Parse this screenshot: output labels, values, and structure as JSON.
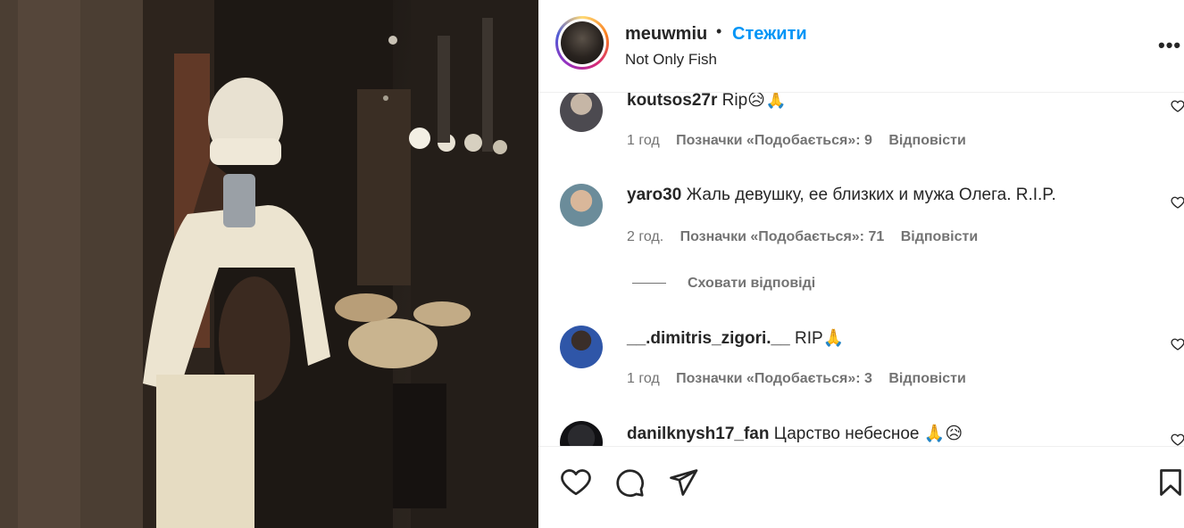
{
  "post": {
    "username": "meuwmiu",
    "follow_label": "Стежити",
    "separator": "•",
    "subtitle": "Not Only Fish",
    "more_icon": "more-horizontal-icon"
  },
  "comments": [
    {
      "user": "koutsos27r",
      "text": "Rip😥🙏",
      "time": "1 год",
      "likes": "Позначки «Подобається»: 9",
      "reply": "Відповісти"
    },
    {
      "user": "yaro30",
      "text": "Жаль девушку, ее близких и мужа Олега. R.I.P.",
      "time": "2 год.",
      "likes": "Позначки «Подобається»: 71",
      "reply": "Відповісти"
    },
    {
      "user": "__.dimitris_zigori.__",
      "text": "RIP🙏",
      "time": "1 год",
      "likes": "Позначки «Подобається»: 3",
      "reply": "Відповісти"
    },
    {
      "user": "danilknysh17_fan",
      "text": "Царство небесное 🙏😥",
      "time": "",
      "likes": "",
      "reply": ""
    }
  ],
  "hide_replies_label": "Сховати відповіді",
  "actions": {
    "like_icon": "heart-icon",
    "comment_icon": "comment-icon",
    "share_icon": "share-icon",
    "save_icon": "bookmark-icon"
  },
  "colors": {
    "accent": "#0095f6",
    "text": "#262626",
    "secondary": "#737373",
    "border": "#efefef"
  }
}
